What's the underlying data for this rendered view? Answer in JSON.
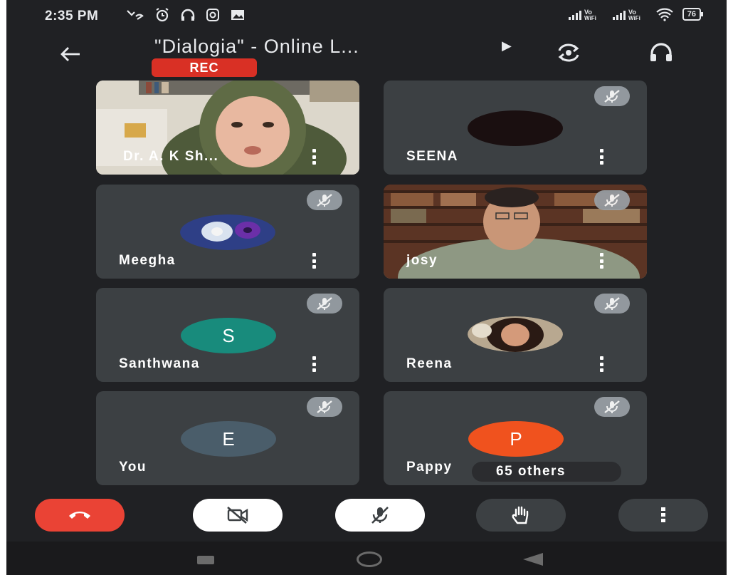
{
  "status_bar": {
    "time": "2:35 PM",
    "battery": "76"
  },
  "header": {
    "meeting_title": "\"Dialogia\" - Online L...",
    "rec_label": "REC"
  },
  "participants": [
    {
      "name": "Dr. A. K Sh...",
      "type": "video",
      "muted": false
    },
    {
      "name": "SEENA",
      "type": "avatar",
      "avatar_color": "#1a0f10",
      "initial": "",
      "muted": true
    },
    {
      "name": "Meegha",
      "type": "photo-avatar",
      "muted": true
    },
    {
      "name": "josy",
      "type": "video",
      "muted": true
    },
    {
      "name": "Santhwana",
      "type": "avatar",
      "avatar_color": "#188b7c",
      "initial": "S",
      "muted": true
    },
    {
      "name": "Reena",
      "type": "photo-avatar",
      "muted": true
    },
    {
      "name": "You",
      "type": "avatar",
      "avatar_color": "#4a5d6a",
      "initial": "E",
      "muted": true
    },
    {
      "name": "Pappy",
      "type": "avatar",
      "avatar_color": "#f0521e",
      "initial": "P",
      "muted": true
    }
  ],
  "others_label": "65 others",
  "controls": {
    "end_call_color": "#ea4335",
    "camera_state": "off",
    "mic_state": "off"
  },
  "colors": {
    "background": "#202124",
    "tile": "#3c4043",
    "rec": "#d93025"
  }
}
